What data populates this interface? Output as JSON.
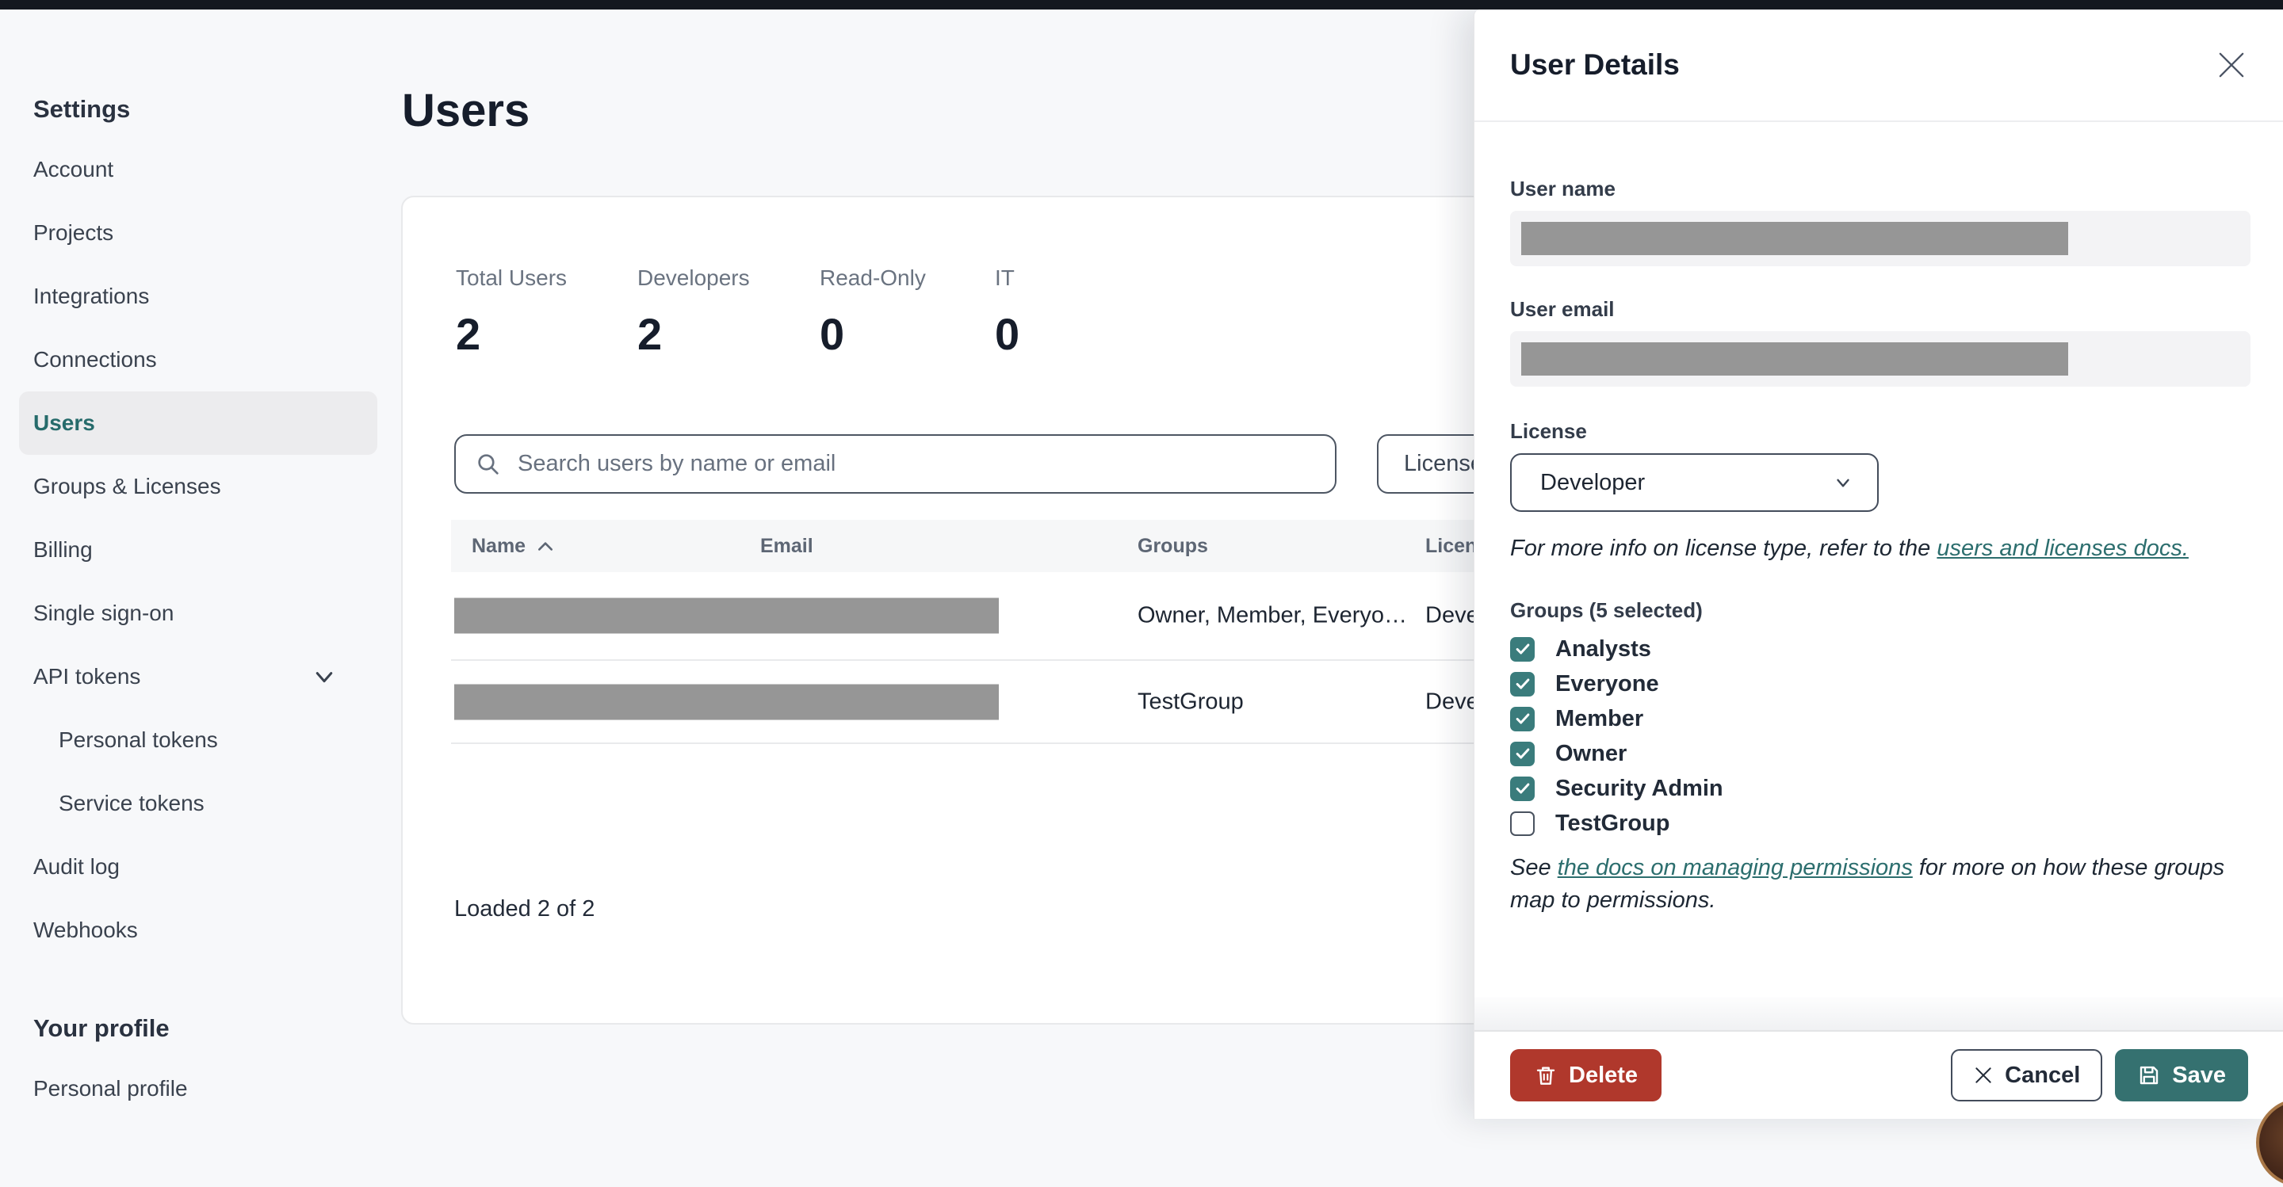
{
  "colors": {
    "topbar": "#14181f",
    "accent_teal": "#2c6e6e",
    "checkbox_teal": "#3a7c7c",
    "save_teal": "#357170",
    "delete_red": "#b0382c",
    "redaction_gray": "#969696"
  },
  "sidebar": {
    "section_title": "Settings",
    "items": [
      {
        "label": "Account"
      },
      {
        "label": "Projects"
      },
      {
        "label": "Integrations"
      },
      {
        "label": "Connections"
      },
      {
        "label": "Users",
        "active": true
      },
      {
        "label": "Groups & Licenses"
      },
      {
        "label": "Billing"
      },
      {
        "label": "Single sign-on"
      },
      {
        "label": "API tokens",
        "expandable": true
      },
      {
        "label": "Personal tokens",
        "indent": true
      },
      {
        "label": "Service tokens",
        "indent": true
      },
      {
        "label": "Audit log"
      },
      {
        "label": "Webhooks"
      }
    ],
    "profile_section_title": "Your profile",
    "profile_items": [
      {
        "label": "Personal profile"
      }
    ]
  },
  "main": {
    "page_title": "Users",
    "stats": [
      {
        "label": "Total Users",
        "value": "2"
      },
      {
        "label": "Developers",
        "value": "2"
      },
      {
        "label": "Read-Only",
        "value": "0"
      },
      {
        "label": "IT",
        "value": "0"
      }
    ],
    "search": {
      "placeholder": "Search users by name or email"
    },
    "license_filter": {
      "label": "License"
    },
    "table": {
      "headers": {
        "name": "Name",
        "email": "Email",
        "groups": "Groups",
        "license": "License"
      },
      "rows": [
        {
          "name_redacted": true,
          "email_redacted": true,
          "groups": "Owner, Member, Everyo…",
          "license": "Developer"
        },
        {
          "name_redacted": true,
          "email_redacted": true,
          "groups": "TestGroup",
          "license": "Developer"
        }
      ]
    },
    "status": {
      "loaded_text": "Loaded 2 of 2"
    }
  },
  "drawer": {
    "title": "User Details",
    "user_name": {
      "label": "User name",
      "value_redacted": true
    },
    "user_email": {
      "label": "User email",
      "value_redacted": true
    },
    "license": {
      "label": "License",
      "value": "Developer"
    },
    "license_note": {
      "text": "For more info on license type, refer to the ",
      "link_text": "users and licenses docs."
    },
    "groups": {
      "label": "Groups (5 selected)",
      "options": [
        {
          "name": "Analysts",
          "checked": true
        },
        {
          "name": "Everyone",
          "checked": true
        },
        {
          "name": "Member",
          "checked": true
        },
        {
          "name": "Owner",
          "checked": true
        },
        {
          "name": "Security Admin",
          "checked": true
        },
        {
          "name": "TestGroup",
          "checked": false
        }
      ]
    },
    "permissions_note": {
      "prefix": "See ",
      "link_text": "the docs on managing permissions",
      "suffix": " for more on how these groups map to permissions."
    },
    "actions": {
      "delete": "Delete",
      "cancel": "Cancel",
      "save": "Save"
    }
  }
}
